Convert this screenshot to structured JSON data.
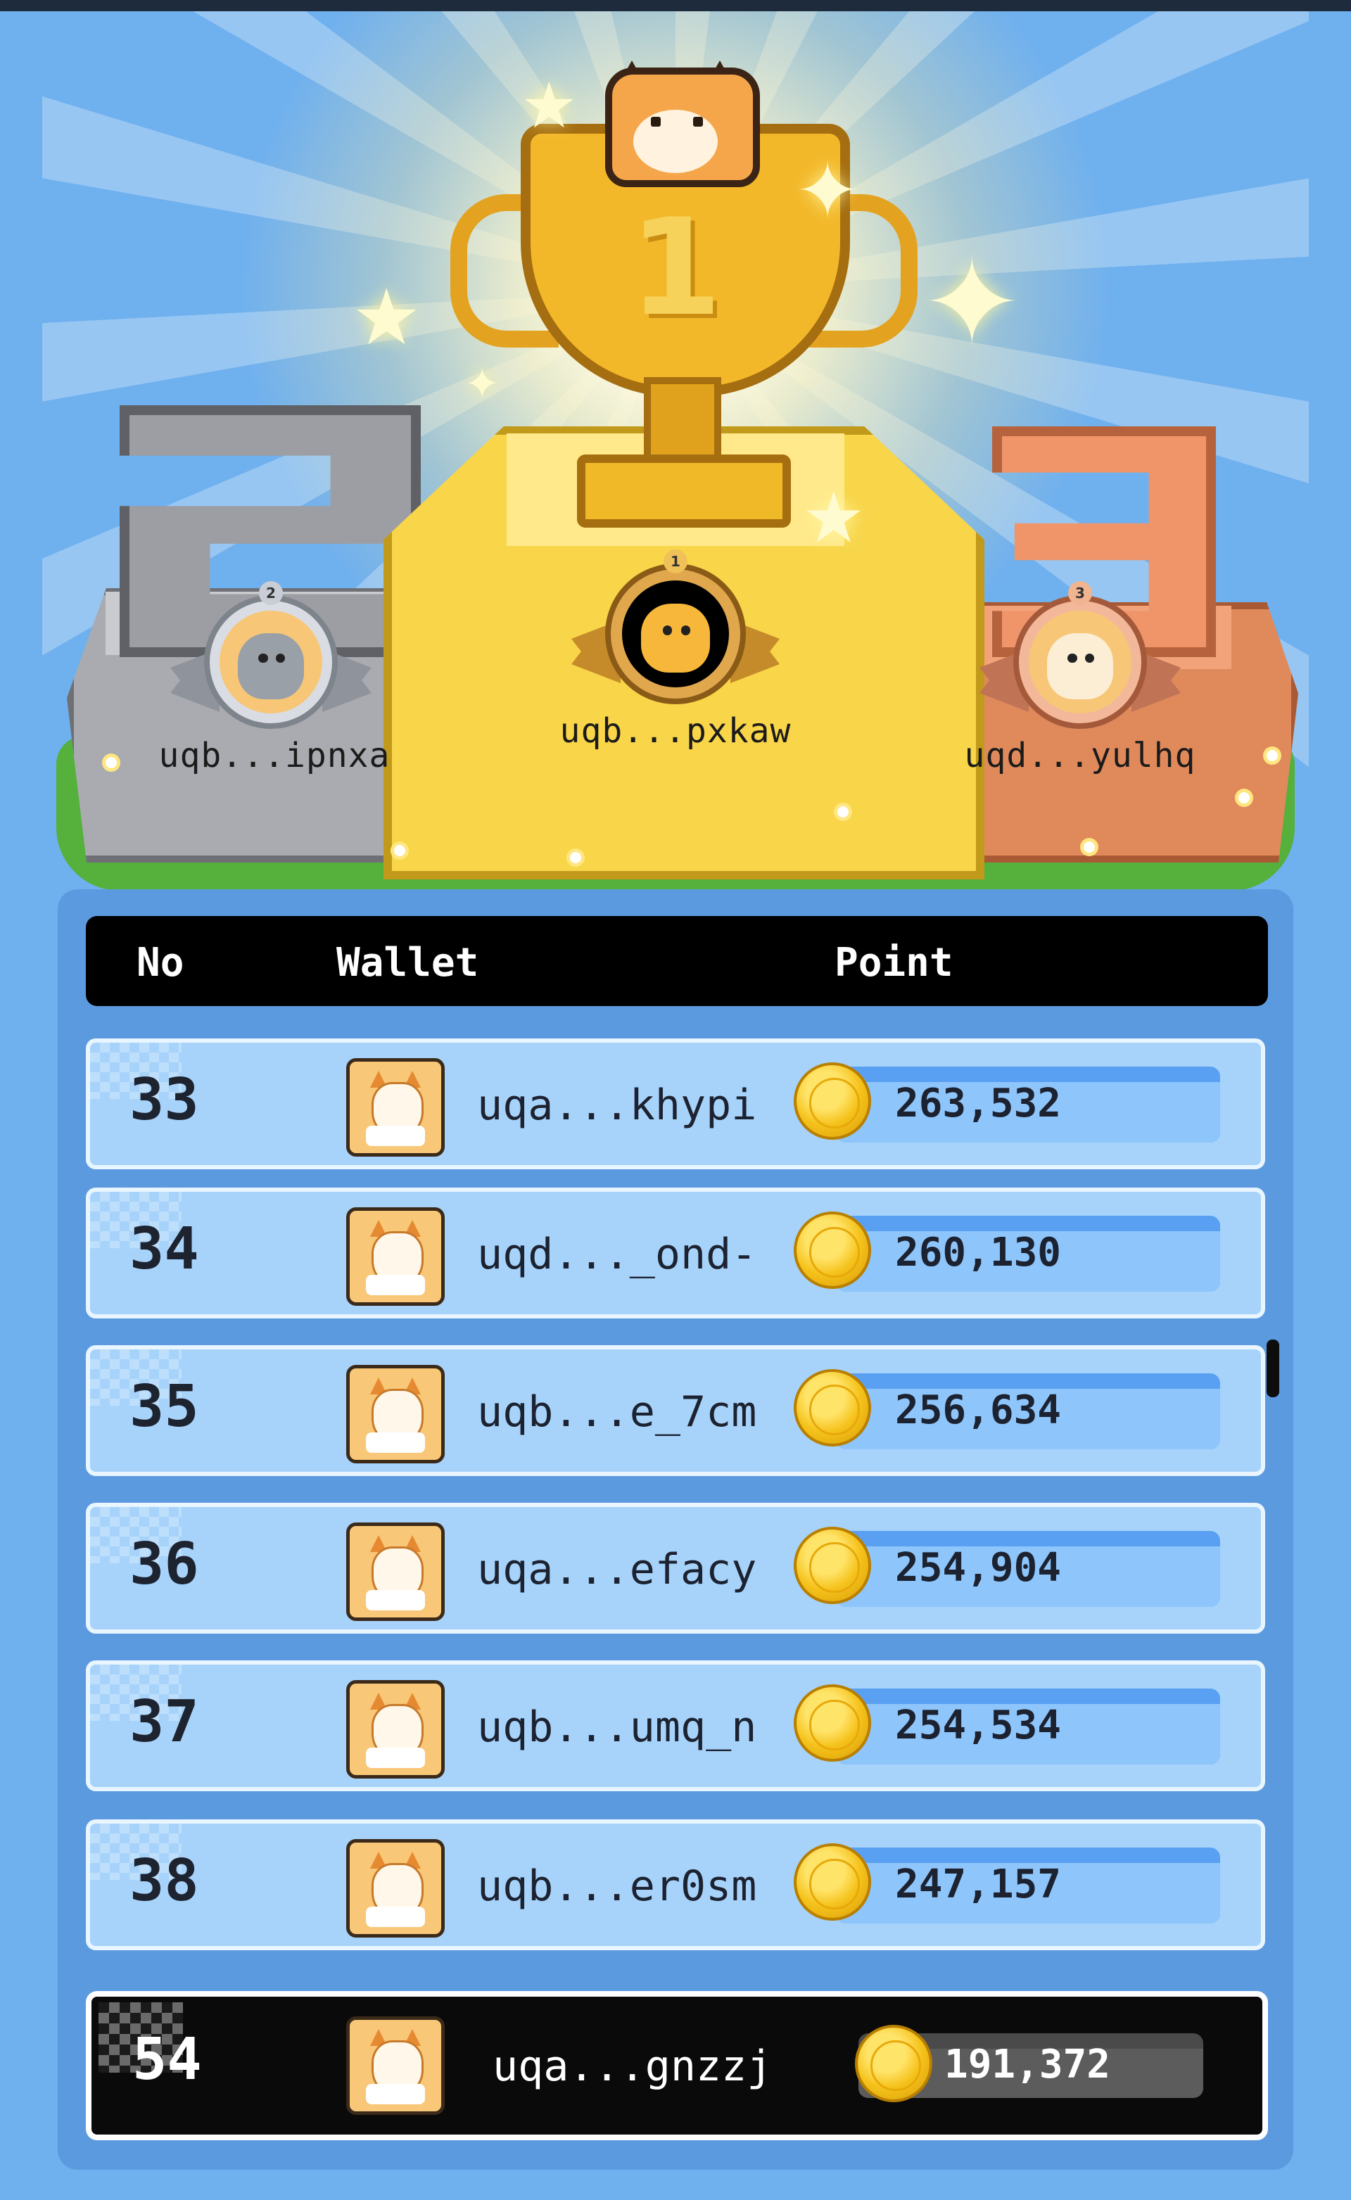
{
  "podium": [
    {
      "rank": "2",
      "wallet": "uqb...ipnxa",
      "place_label": "2"
    },
    {
      "rank": "1",
      "wallet": "uqb...pxkaw",
      "place_label": "1"
    },
    {
      "rank": "3",
      "wallet": "uqd...yulhq",
      "place_label": "3"
    }
  ],
  "table": {
    "headers": {
      "no": "No",
      "wallet": "Wallet",
      "point": "Point"
    },
    "rows": [
      {
        "rank": "33",
        "wallet": "uqa...khypi",
        "points": "263,532"
      },
      {
        "rank": "34",
        "wallet": "uqd..._ond-",
        "points": "260,130"
      },
      {
        "rank": "35",
        "wallet": "uqb...e_7cm",
        "points": "256,634"
      },
      {
        "rank": "36",
        "wallet": "uqa...efacy",
        "points": "254,904"
      },
      {
        "rank": "37",
        "wallet": "uqb...umq_n",
        "points": "254,534"
      },
      {
        "rank": "38",
        "wallet": "uqb...er0sm",
        "points": "247,157"
      }
    ]
  },
  "current_user": {
    "rank": "54",
    "wallet": "uqa...gnzzj",
    "points": "191,372"
  },
  "icons": {
    "avatar": "shiba-avatar-icon",
    "coin": "coin-icon",
    "trophy": "trophy-icon",
    "medal": "medal-icon"
  },
  "colors": {
    "background": "#6fb0ee",
    "panel": "#5c9ae0",
    "row": "#a7d3fb",
    "header": "#000000",
    "gold": "#f8d549",
    "silver": "#a9abb0",
    "bronze": "#e08a5c"
  }
}
